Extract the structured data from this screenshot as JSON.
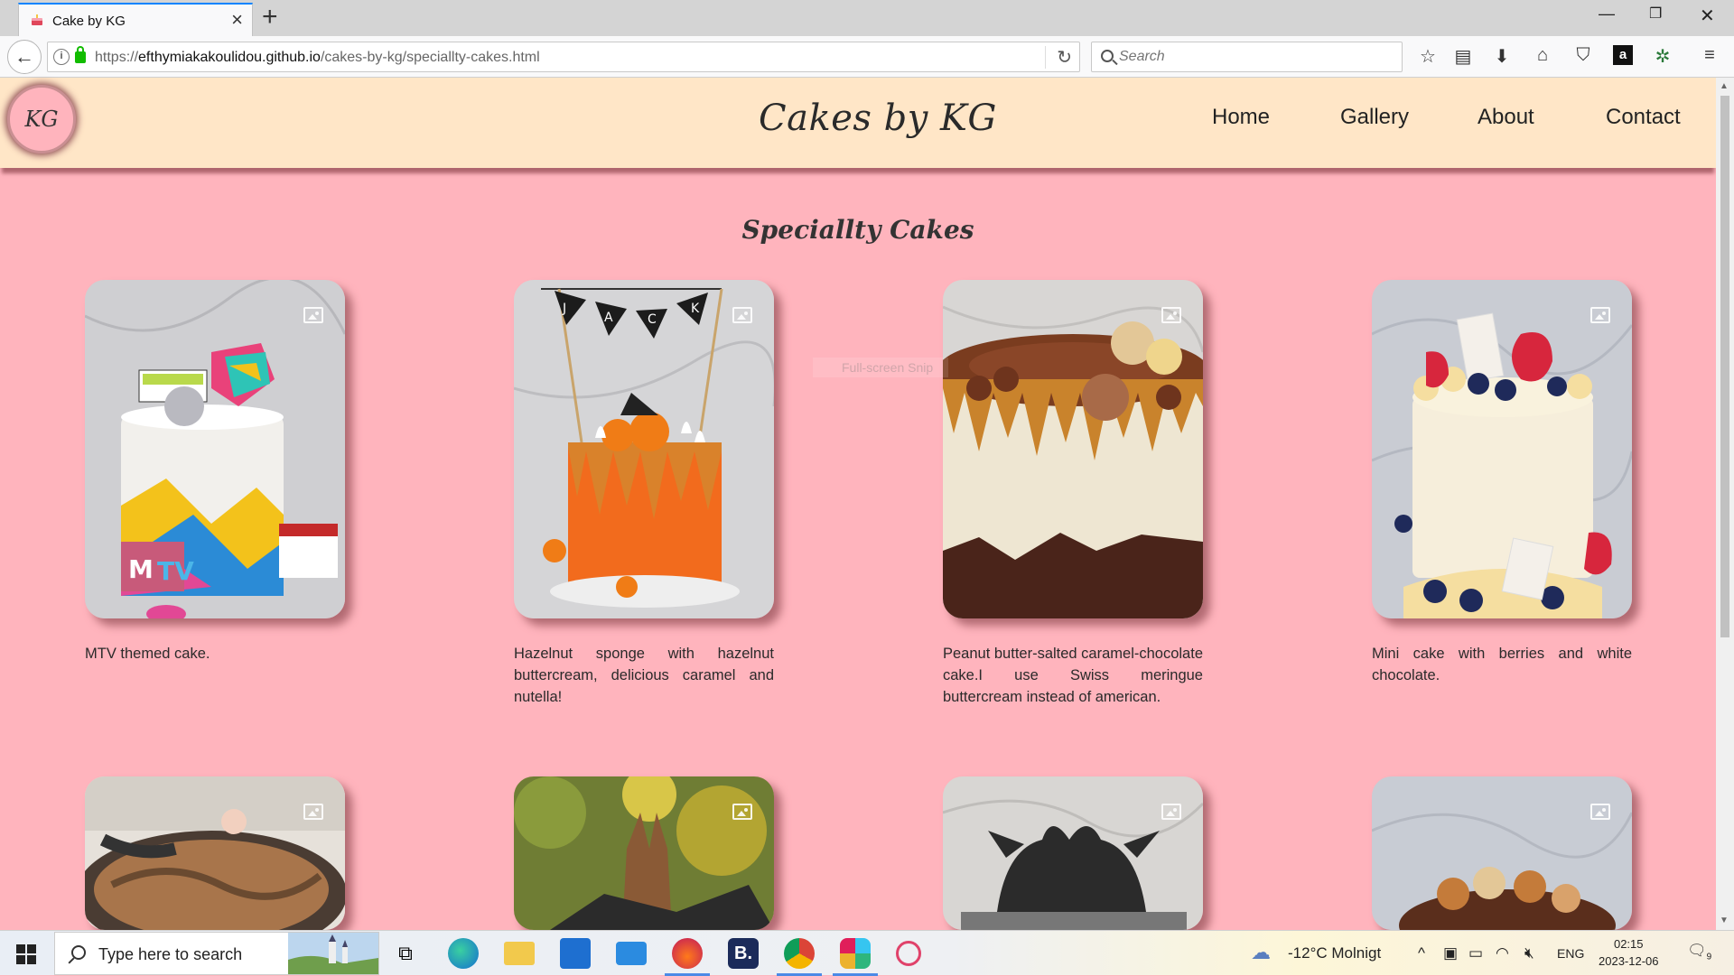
{
  "browser": {
    "tab_title": "Cake by KG",
    "url_host": "efthymiakakoulidou.github.io",
    "url_path": "/cakes-by-kg/speciallty-cakes.html",
    "url_scheme": "https://",
    "search_placeholder": "Search"
  },
  "site": {
    "logo_text": "KG",
    "title": "Cakes by KG",
    "nav": [
      "Home",
      "Gallery",
      "About",
      "Contact"
    ],
    "page_heading": "Speciallty Cakes"
  },
  "cakes": [
    {
      "caption": "MTV themed cake.",
      "icon": "image-gallery-icon"
    },
    {
      "caption": "Hazelnut sponge with hazelnut buttercream, delicious caramel and nutella!",
      "icon": "image-gallery-icon"
    },
    {
      "caption": "Peanut butter-salted caramel-chocolate cake.I use Swiss meringue buttercream instead of american.",
      "icon": "image-gallery-icon"
    },
    {
      "caption": "Mini cake with berries and white chocolate.",
      "icon": "image-gallery-icon"
    }
  ],
  "overlay_text": "Full-screen Snip",
  "taskbar": {
    "search_placeholder": "Type here to search",
    "weather": "-12°C  Molnigt",
    "lang": "ENG",
    "time": "02:15",
    "date": "2023-12-06",
    "notifications": "9"
  },
  "colors": {
    "page_bg": "#ffb4bd",
    "header_bg": "#ffe6c7",
    "accent": "#0a84ff"
  }
}
